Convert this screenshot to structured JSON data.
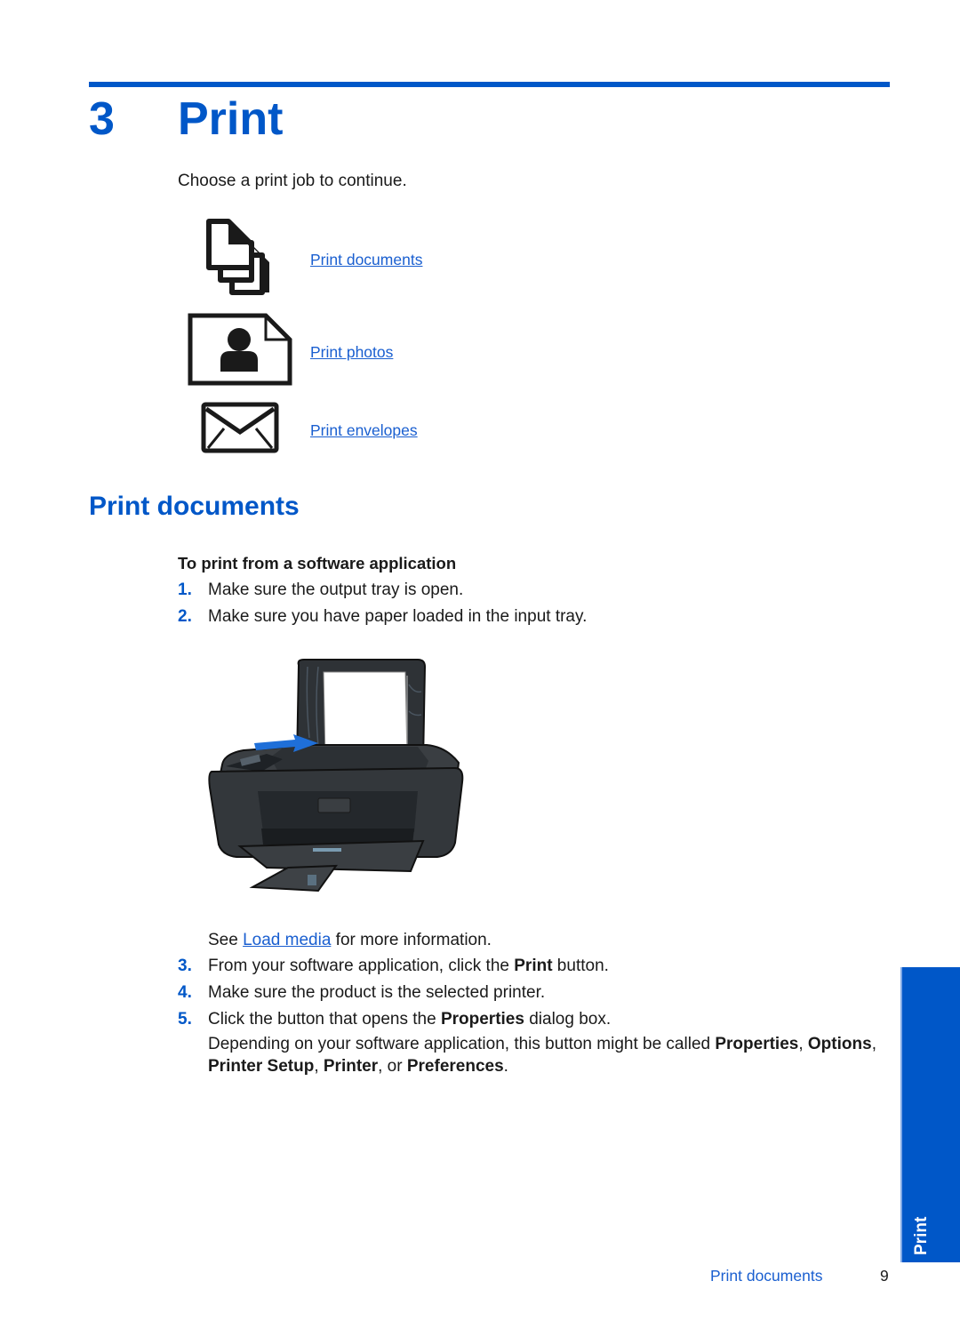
{
  "chapter": {
    "number": "3",
    "title": "Print"
  },
  "intro": "Choose a print job to continue.",
  "print_jobs": [
    {
      "label": "Print documents",
      "icon": "documents-icon"
    },
    {
      "label": "Print photos",
      "icon": "photo-icon"
    },
    {
      "label": "Print envelopes",
      "icon": "envelope-icon"
    }
  ],
  "section": {
    "title": "Print documents",
    "procedure_title": "To print from a software application",
    "steps": [
      {
        "num": "1.",
        "text": "Make sure the output tray is open."
      },
      {
        "num": "2.",
        "text": "Make sure you have paper loaded in the input tray."
      }
    ],
    "see_also": {
      "prefix": "See ",
      "link": "Load media",
      "suffix": " for more information."
    },
    "steps_after": [
      {
        "num": "3.",
        "pre": "From your software application, click the ",
        "bold": "Print",
        "post": " button."
      },
      {
        "num": "4.",
        "text": "Make sure the product is the selected printer."
      },
      {
        "num": "5.",
        "pre": "Click the button that opens the ",
        "bold": "Properties",
        "post": " dialog box."
      }
    ],
    "note": {
      "pre": "Depending on your software application, this button might be called ",
      "b1": "Properties",
      "s1": ", ",
      "b2": "Options",
      "s2": ", ",
      "b3": "Printer Setup",
      "s3": ", ",
      "b4": "Printer",
      "s4": ", or ",
      "b5": "Preferences",
      "s5": "."
    }
  },
  "side_tab": "Print",
  "footer": {
    "section": "Print documents",
    "page": "9"
  },
  "colors": {
    "accent": "#0057c8",
    "link": "#1a5fd0",
    "text": "#1a1a1a"
  }
}
